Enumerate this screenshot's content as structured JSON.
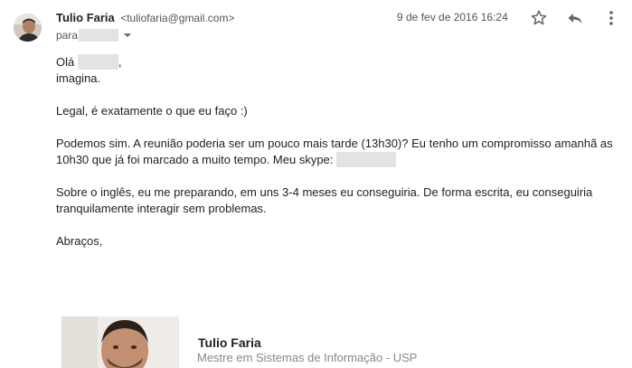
{
  "header": {
    "sender_name": "Tulio Faria",
    "sender_email": "<tuliofaria@gmail.com>",
    "to_label": "para",
    "date": "9 de fev de 2016 16:24"
  },
  "icons": {
    "avatar": "avatar",
    "star": "star-icon",
    "reply": "reply-icon",
    "more": "more-vert-icon",
    "recipient_dropdown": "chevron-down-icon"
  },
  "body": {
    "greeting": "Olá",
    "greeting_suffix": ",",
    "line_imagina": "imagina.",
    "p1": "Legal, é exatamente o que eu faço :)",
    "p2": "Podemos sim. A reunião poderia ser um pouco mais tarde (13h30)? Eu tenho um compromisso amanhã as 10h30 que já foi marcado a muito tempo. Meu skype:",
    "p3": "Sobre o inglês, eu me preparando, em uns 3-4 meses eu conseguiria. De forma escrita, eu conseguiria tranquilamente interagir sem problemas.",
    "closing": "Abraços,"
  },
  "signature": {
    "name": "Tulio Faria",
    "title": "Mestre em Sistemas de Informação - USP"
  },
  "colors": {
    "text": "#222222",
    "muted": "#555555",
    "signature_title": "#888888",
    "redaction": "#e3e3e3"
  }
}
